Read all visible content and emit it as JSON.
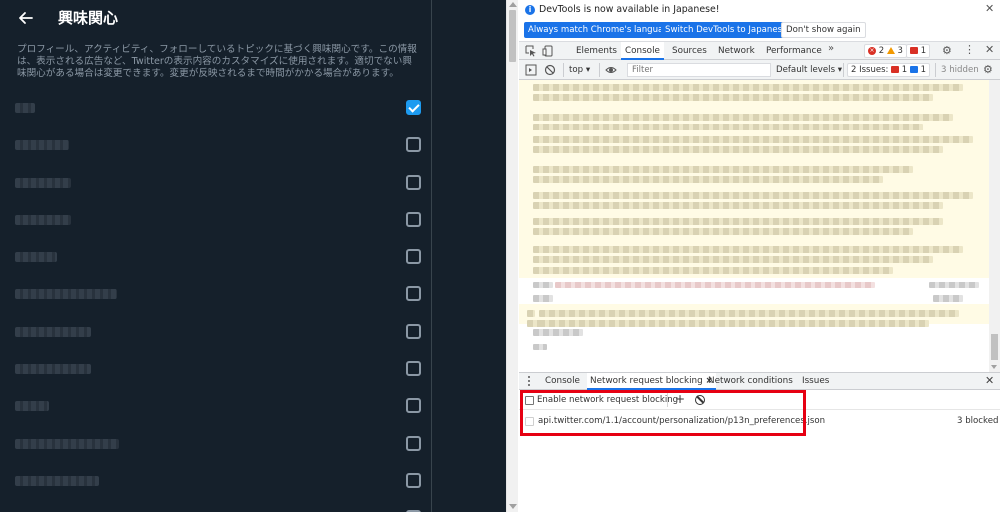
{
  "twitter": {
    "title": "興味関心",
    "description": "プロフィール、アクティビティ、フォローしているトピックに基づく興味関心です。この情報は、表示される広告など、Twitterの表示内容のカスタマイズに使用されます。適切でない興味関心がある場合は変更できます。変更が反映されるまで時間がかかる場合があります。",
    "interests": [
      {
        "checked": true
      },
      {
        "checked": false
      },
      {
        "checked": false
      },
      {
        "checked": false
      },
      {
        "checked": false
      },
      {
        "checked": false
      },
      {
        "checked": false
      },
      {
        "checked": false
      },
      {
        "checked": false
      },
      {
        "checked": false
      },
      {
        "checked": false
      },
      {
        "checked": false
      }
    ]
  },
  "devtools": {
    "infobar": {
      "message": "DevTools is now available in Japanese!",
      "btn_match": "Always match Chrome's language",
      "btn_switch": "Switch DevTools to Japanese",
      "btn_dismiss": "Don't show again"
    },
    "tabs": [
      "Elements",
      "Console",
      "Sources",
      "Network",
      "Performance"
    ],
    "active_tab": "Console",
    "more": "»",
    "errors": "2",
    "warnings": "3",
    "issues_count": "1",
    "toolbar": {
      "context": "top",
      "filter_placeholder": "Filter",
      "levels": "Default levels",
      "issues_label": "2 Issues:",
      "issues_red": "1",
      "issues_blue": "1",
      "hidden": "3 hidden"
    },
    "drawer_tabs": [
      "Console",
      "Network request blocking",
      "Network conditions",
      "Issues"
    ],
    "active_drawer_tab": "Network request blocking",
    "blocking": {
      "enable_label": "Enable network request blocking",
      "pattern": "api.twitter.com/1.1/account/personalization/p13n_preferences.json",
      "count": "3 blocked"
    }
  },
  "colors": {
    "twitter_bg": "#15202b",
    "twitter_accent": "#1d9bf0",
    "devtools_accent": "#1a73e8",
    "highlight": "#e60012"
  }
}
